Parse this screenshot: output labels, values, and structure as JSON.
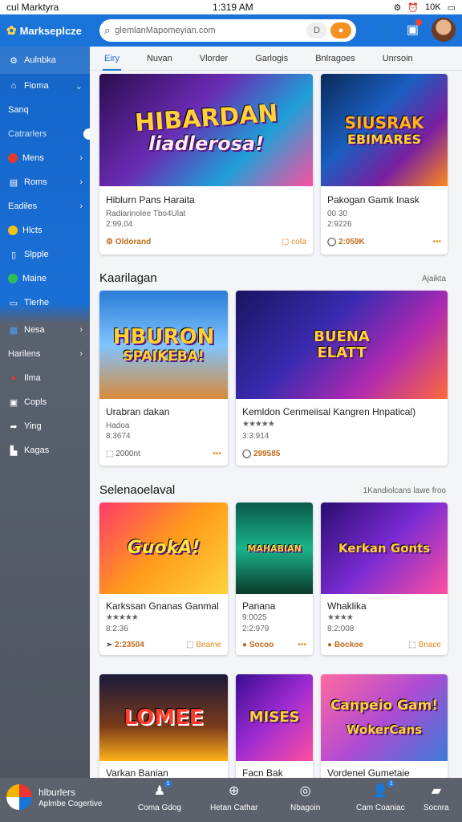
{
  "status": {
    "left": "cul Marktyra",
    "time": "1:319 AM",
    "right": "10K"
  },
  "header": {
    "brand": "Markseplcze",
    "search_placeholder": "glemlanMapomeyian.com",
    "search_btn": "D",
    "colors": {
      "topbar": "#1a73d9",
      "accent": "#f39222"
    }
  },
  "sidebar": {
    "items": [
      {
        "label": "Aulnbka",
        "icon": "gear-icon"
      },
      {
        "label": "Fioma",
        "icon": "home-icon",
        "chev": "v"
      },
      {
        "label": "Sanq",
        "icon": ""
      },
      {
        "label": "Catrarlers",
        "icon": ""
      },
      {
        "label": "Mens",
        "icon": "red-dot-icon",
        "chev": ">"
      },
      {
        "label": "Roms",
        "icon": "image-icon",
        "chev": ">"
      },
      {
        "label": "Eadiles",
        "icon": "",
        "chev": ">"
      },
      {
        "label": "Hlcts",
        "icon": "yellow-dot-icon"
      },
      {
        "label": "Slpple",
        "icon": "phone-icon"
      },
      {
        "label": "Maine",
        "icon": "check-icon"
      },
      {
        "label": "Tlerhe",
        "icon": "tablet-icon"
      },
      {
        "label": "Nesa",
        "icon": "grid-icon",
        "chev": ">"
      },
      {
        "label": "Harilens",
        "icon": "",
        "chev": ">"
      },
      {
        "label": "Ilma",
        "icon": "red-small-dot-icon"
      },
      {
        "label": "Copls",
        "icon": "camera-icon"
      },
      {
        "label": "Ying",
        "icon": "share-icon"
      },
      {
        "label": "Kagas",
        "icon": "store-icon"
      }
    ]
  },
  "tabs": [
    "Eiry",
    "Nuvan",
    "Vlorder",
    "Garlogis",
    "Bnlragoes",
    "Unrsoin"
  ],
  "row1": [
    {
      "art": "HIBARDAN",
      "art2": "liadlerosa!",
      "title": "Hiblurn Pans Haraita",
      "sub1": "Radiarinolee Tbo4Ulat",
      "sub2": "2:99,04",
      "foot_l": "Oldorand",
      "foot_r": "cota"
    },
    {
      "art": "SIUSRAK",
      "art2": "EBIMARES",
      "title": "Pakogan Gamk Inask",
      "sub1": "00 30",
      "sub2": "2:9226",
      "foot_l": "2:059K",
      "foot_r": "•••"
    }
  ],
  "section1": {
    "title": "Kaarilagan",
    "right": "Ajaikta"
  },
  "row2": [
    {
      "art": "HBURON",
      "art2": "SPAIKEBA!",
      "title": "Urabran dakan",
      "sub1": "Hadoa",
      "sub2": "8:3674",
      "foot_l": "2000nt",
      "foot_r": "•••"
    },
    {
      "art": "BUENA",
      "art2": "ELATT",
      "title": "Kemldon Cenmeiisal Kangren Hnpatical)",
      "stars": "★★★★★",
      "sub2": "3:3:914",
      "foot_l": "299585",
      "foot_r": ""
    }
  ],
  "section2": {
    "title": "Selenaoelaval",
    "right": "1Kandiolcans lawe froo"
  },
  "row3": [
    {
      "art": "GuokA!",
      "title": "Karkssan Gnanas Ganmal",
      "stars": "★★★★★",
      "sub2": "8:2:36",
      "foot_l": "2:23504",
      "foot_r": "Beame"
    },
    {
      "art": "MAHABIAN",
      "title": "Panana",
      "sub1": "9:0025",
      "sub2": "2:2:979",
      "foot_l": "Socoo",
      "foot_r": "•••"
    },
    {
      "art": "Kerkan Gonts",
      "title": "Whaklika",
      "stars": "★★★★",
      "sub2": "8:2:008",
      "foot_l": "Bockoe",
      "foot_r": "Bnace"
    }
  ],
  "row4": [
    {
      "art": "LOMEE",
      "title": "Varkan Banian"
    },
    {
      "art": "MISES",
      "title": "Facn Bak"
    },
    {
      "art": "Canpeio Gam!",
      "art2": "WokerCans",
      "title": "Vordenel Gumetaie"
    }
  ],
  "bottom": {
    "acct_title": "hlburlers",
    "acct_sub": "Aplmbe Cogertive",
    "nav": [
      {
        "label": "Coma Gdog",
        "icon": "game-icon"
      },
      {
        "label": "Hetan Cathar",
        "icon": "plus-circle-icon"
      },
      {
        "label": "Nbagoin",
        "icon": "target-icon"
      },
      {
        "label": "Cam Coaniac",
        "icon": "user-icon"
      },
      {
        "label": "Socnra",
        "icon": "bag-icon"
      }
    ]
  }
}
